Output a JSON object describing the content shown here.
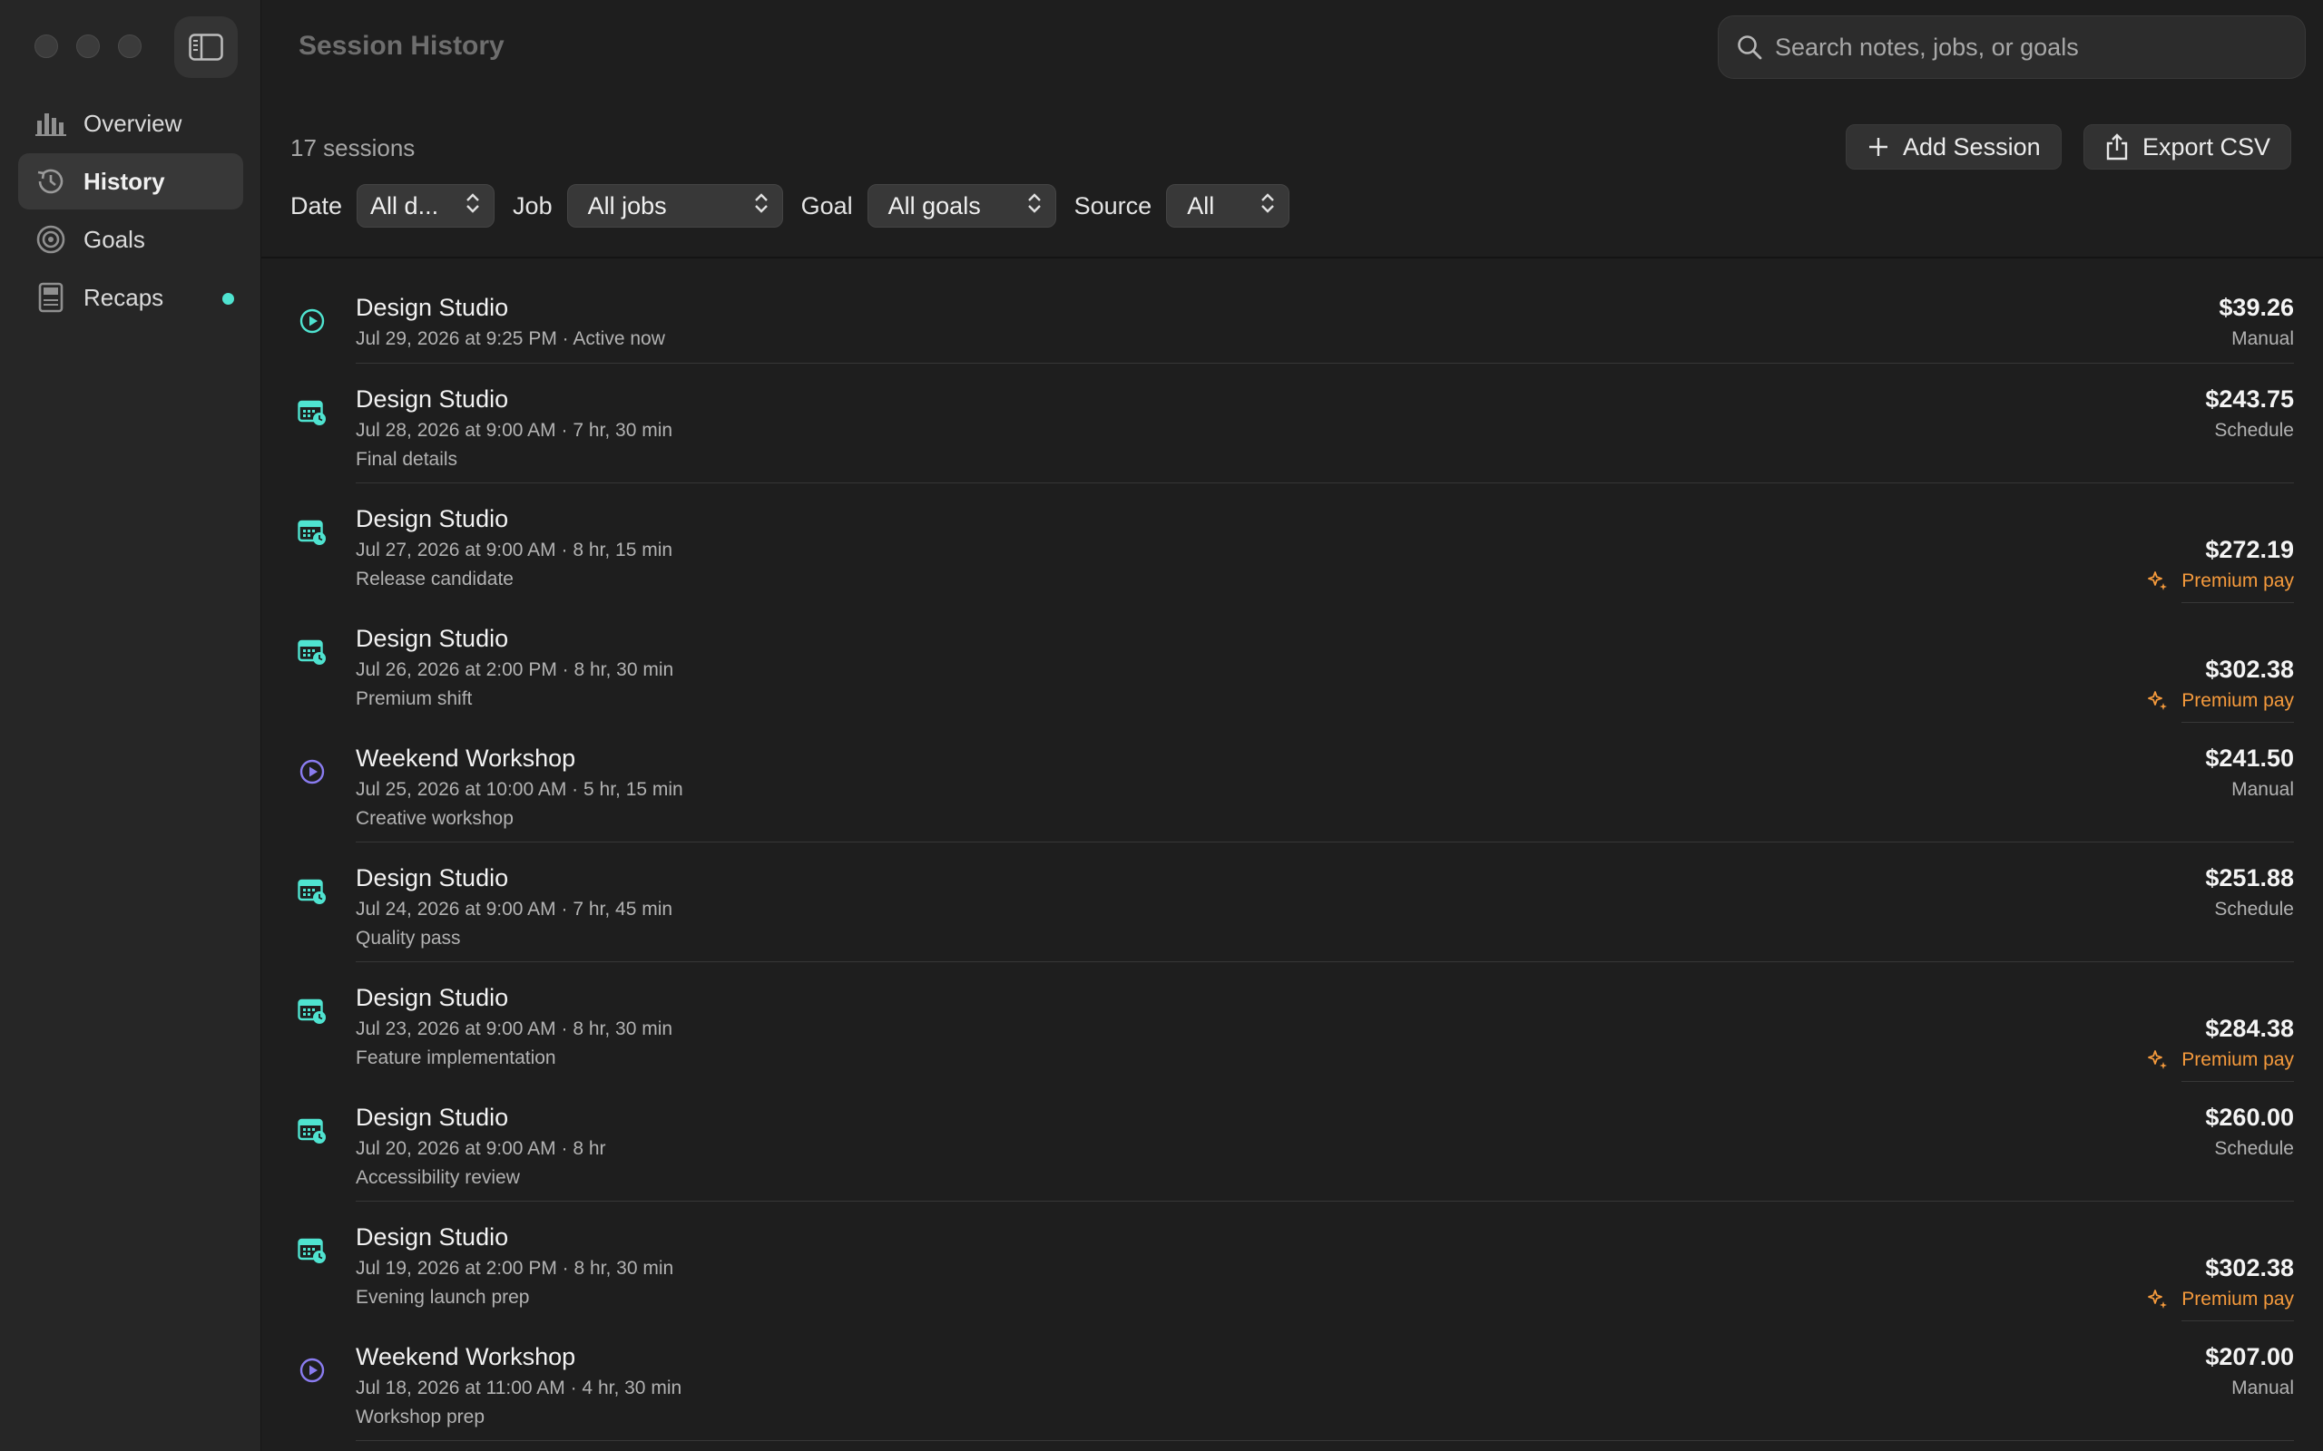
{
  "window": {
    "title": "Session History"
  },
  "sidebar": {
    "items": [
      {
        "label": "Overview",
        "icon": "chart-bar-icon",
        "active": false
      },
      {
        "label": "History",
        "icon": "clock-history-icon",
        "active": true
      },
      {
        "label": "Goals",
        "icon": "target-icon",
        "active": false
      },
      {
        "label": "Recaps",
        "icon": "document-icon",
        "active": false,
        "badge": true
      }
    ]
  },
  "search": {
    "placeholder": "Search notes, jobs, or goals"
  },
  "summary": {
    "count": "17 sessions"
  },
  "toolbar": {
    "add_label": "Add Session",
    "export_label": "Export CSV"
  },
  "filters": {
    "date_label": "Date",
    "date_value": "All d...",
    "job_label": "Job",
    "job_value": "All jobs",
    "goal_label": "Goal",
    "goal_value": "All goals",
    "source_label": "Source",
    "source_value": "All"
  },
  "colors": {
    "accent_teal": "#4fe3d0",
    "accent_purple": "#8a7cf0",
    "premium": "#f59a3c"
  },
  "sessions": [
    {
      "title": "Design Studio",
      "meta": "Jul 29, 2026 at 9:25 PM · Active now",
      "note": "",
      "amount": "$39.26",
      "source": "Manual",
      "icon": "play-circle-icon",
      "icon_color": "#4fe3d0",
      "premium": false
    },
    {
      "title": "Design Studio",
      "meta": "Jul 28, 2026 at 9:00 AM · 7 hr, 30 min",
      "note": "Final details",
      "amount": "$243.75",
      "source": "Schedule",
      "icon": "calendar-clock-icon",
      "icon_color": "#4fe3d0",
      "premium": false
    },
    {
      "title": "Design Studio",
      "meta": "Jul 27, 2026 at 9:00 AM · 8 hr, 15 min",
      "note": "Release candidate",
      "amount": "$272.19",
      "source": "Premium pay",
      "icon": "calendar-clock-icon",
      "icon_color": "#4fe3d0",
      "premium": true
    },
    {
      "title": "Design Studio",
      "meta": "Jul 26, 2026 at 2:00 PM · 8 hr, 30 min",
      "note": "Premium shift",
      "amount": "$302.38",
      "source": "Premium pay",
      "icon": "calendar-clock-icon",
      "icon_color": "#4fe3d0",
      "premium": true
    },
    {
      "title": "Weekend Workshop",
      "meta": "Jul 25, 2026 at 10:00 AM · 5 hr, 15 min",
      "note": "Creative workshop",
      "amount": "$241.50",
      "source": "Manual",
      "icon": "play-circle-icon",
      "icon_color": "#8a7cf0",
      "premium": false
    },
    {
      "title": "Design Studio",
      "meta": "Jul 24, 2026 at 9:00 AM · 7 hr, 45 min",
      "note": "Quality pass",
      "amount": "$251.88",
      "source": "Schedule",
      "icon": "calendar-clock-icon",
      "icon_color": "#4fe3d0",
      "premium": false
    },
    {
      "title": "Design Studio",
      "meta": "Jul 23, 2026 at 9:00 AM · 8 hr, 30 min",
      "note": "Feature implementation",
      "amount": "$284.38",
      "source": "Premium pay",
      "icon": "calendar-clock-icon",
      "icon_color": "#4fe3d0",
      "premium": true
    },
    {
      "title": "Design Studio",
      "meta": "Jul 20, 2026 at 9:00 AM · 8 hr",
      "note": "Accessibility review",
      "amount": "$260.00",
      "source": "Schedule",
      "icon": "calendar-clock-icon",
      "icon_color": "#4fe3d0",
      "premium": false
    },
    {
      "title": "Design Studio",
      "meta": "Jul 19, 2026 at 2:00 PM · 8 hr, 30 min",
      "note": "Evening launch prep",
      "amount": "$302.38",
      "source": "Premium pay",
      "icon": "calendar-clock-icon",
      "icon_color": "#4fe3d0",
      "premium": true
    },
    {
      "title": "Weekend Workshop",
      "meta": "Jul 18, 2026 at 11:00 AM · 4 hr, 30 min",
      "note": "Workshop prep",
      "amount": "$207.00",
      "source": "Manual",
      "icon": "play-circle-icon",
      "icon_color": "#8a7cf0",
      "premium": false
    }
  ]
}
